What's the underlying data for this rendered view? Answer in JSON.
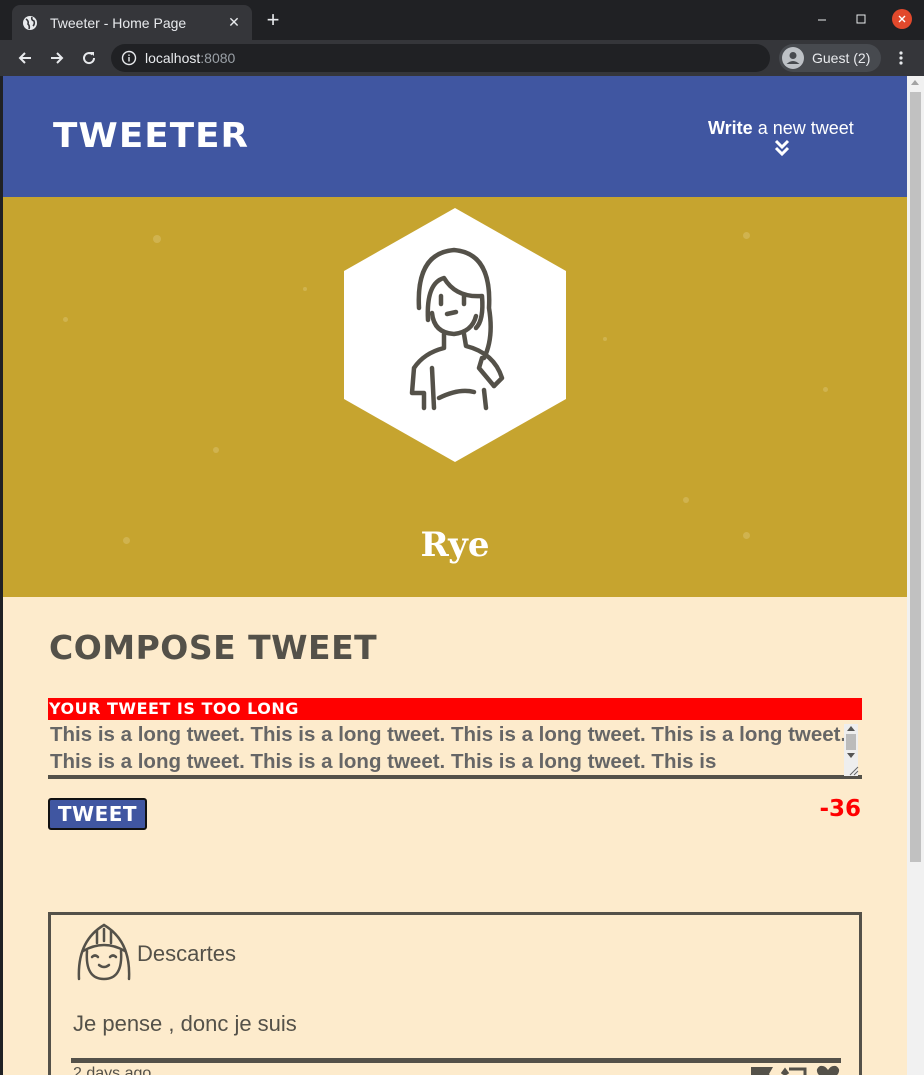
{
  "browser": {
    "tab_title": "Tweeter - Home Page",
    "url_host": "localhost",
    "url_port": ":8080",
    "profile_label": "Guest (2)"
  },
  "nav": {
    "brand": "tweeter",
    "write_bold": "Write",
    "write_rest": " a new tweet"
  },
  "profile": {
    "name": "Rye",
    "header_color": "#c6a42f"
  },
  "compose": {
    "title": "compose tweet",
    "error": "your tweet is too long",
    "text": "This is a long tweet. This is a long tweet. This is a long tweet. This is a long tweet. This is a long tweet. This is a long tweet. This is a long tweet. This is",
    "button": "tweet",
    "counter": "-36"
  },
  "tweet": {
    "user": "Descartes",
    "content": "Je pense , donc je suis",
    "ago": "2 days ago"
  },
  "colors": {
    "nav": "#4056a1",
    "background": "#fdebcc",
    "error": "#ff0000",
    "text": "#545149"
  }
}
